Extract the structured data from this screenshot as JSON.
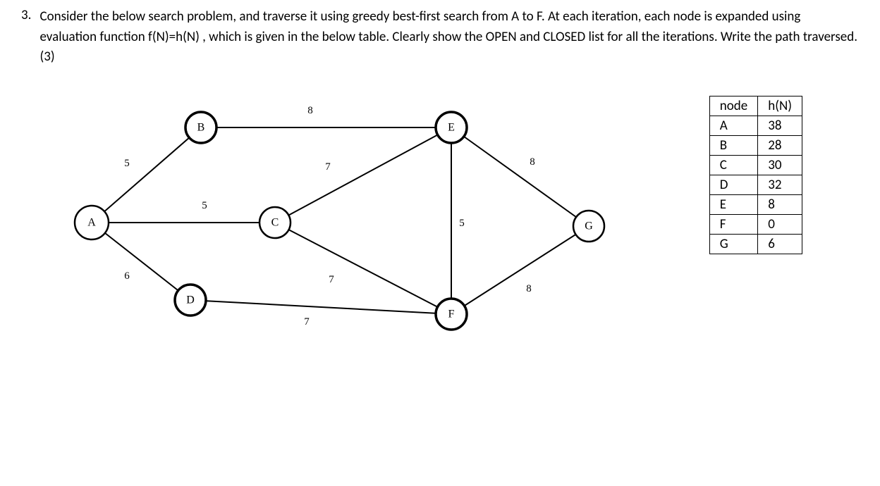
{
  "question": {
    "number": "3.",
    "text": "Consider the below search problem, and traverse it using greedy best-first search from A to F. At each iteration, each node is expanded using evaluation function f(N)=h(N) , which is given in the below table. Clearly show the OPEN and CLOSED list for all the iterations. Write the path traversed.(3)"
  },
  "graph": {
    "nodes": {
      "A": "A",
      "B": "B",
      "C": "C",
      "D": "D",
      "E": "E",
      "F": "F",
      "G": "G"
    },
    "edge_weights": {
      "AB": "5",
      "AC": "5",
      "AD": "6",
      "BE": "8",
      "CE": "7",
      "CF": "7",
      "DF": "7",
      "EF": "5",
      "EG": "8",
      "FG": "8"
    }
  },
  "table": {
    "headers": {
      "col1": "node",
      "col2": "h(N)"
    },
    "rows": [
      {
        "node": "A",
        "h": "38"
      },
      {
        "node": "B",
        "h": "28"
      },
      {
        "node": "C",
        "h": "30"
      },
      {
        "node": "D",
        "h": "32"
      },
      {
        "node": "E",
        "h": "8"
      },
      {
        "node": "F",
        "h": "0"
      },
      {
        "node": "G",
        "h": "6"
      }
    ]
  }
}
